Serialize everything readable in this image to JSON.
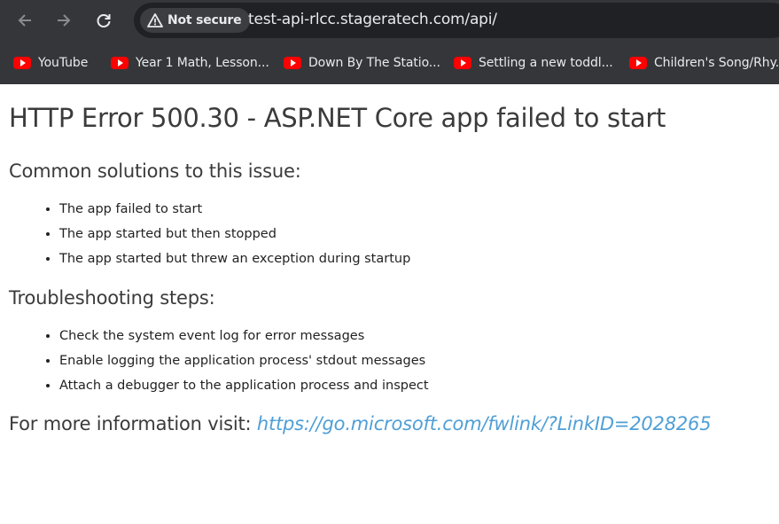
{
  "browser": {
    "security_chip": "Not secure",
    "url": "test-api-rlcc.stageratech.com/api/",
    "bookmarks": [
      {
        "label": "YouTube",
        "icon": "youtube-icon"
      },
      {
        "label": "Year 1 Math, Lesson...",
        "icon": "youtube-icon"
      },
      {
        "label": "Down By The Statio...",
        "icon": "youtube-icon"
      },
      {
        "label": "Settling a new toddl...",
        "icon": "youtube-icon"
      },
      {
        "label": "Children's Song/Rhy...",
        "icon": "youtube-icon"
      }
    ]
  },
  "page": {
    "title": "HTTP Error 500.30 - ASP.NET Core app failed to start",
    "solutions_heading": "Common solutions to this issue:",
    "solutions": [
      "The app failed to start",
      "The app started but then stopped",
      "The app started but threw an exception during startup"
    ],
    "troubleshooting_heading": "Troubleshooting steps:",
    "steps": [
      "Check the system event log for error messages",
      "Enable logging the application process' stdout messages",
      "Attach a debugger to the application process and inspect"
    ],
    "more_info_label": "For more information visit:",
    "more_info_link": "https://go.microsoft.com/fwlink/?LinkID=2028265"
  },
  "colors": {
    "chrome_bg": "#35363a",
    "address_bg": "#202124",
    "link": "#4f9fd6",
    "youtube_red": "#ff0000"
  }
}
